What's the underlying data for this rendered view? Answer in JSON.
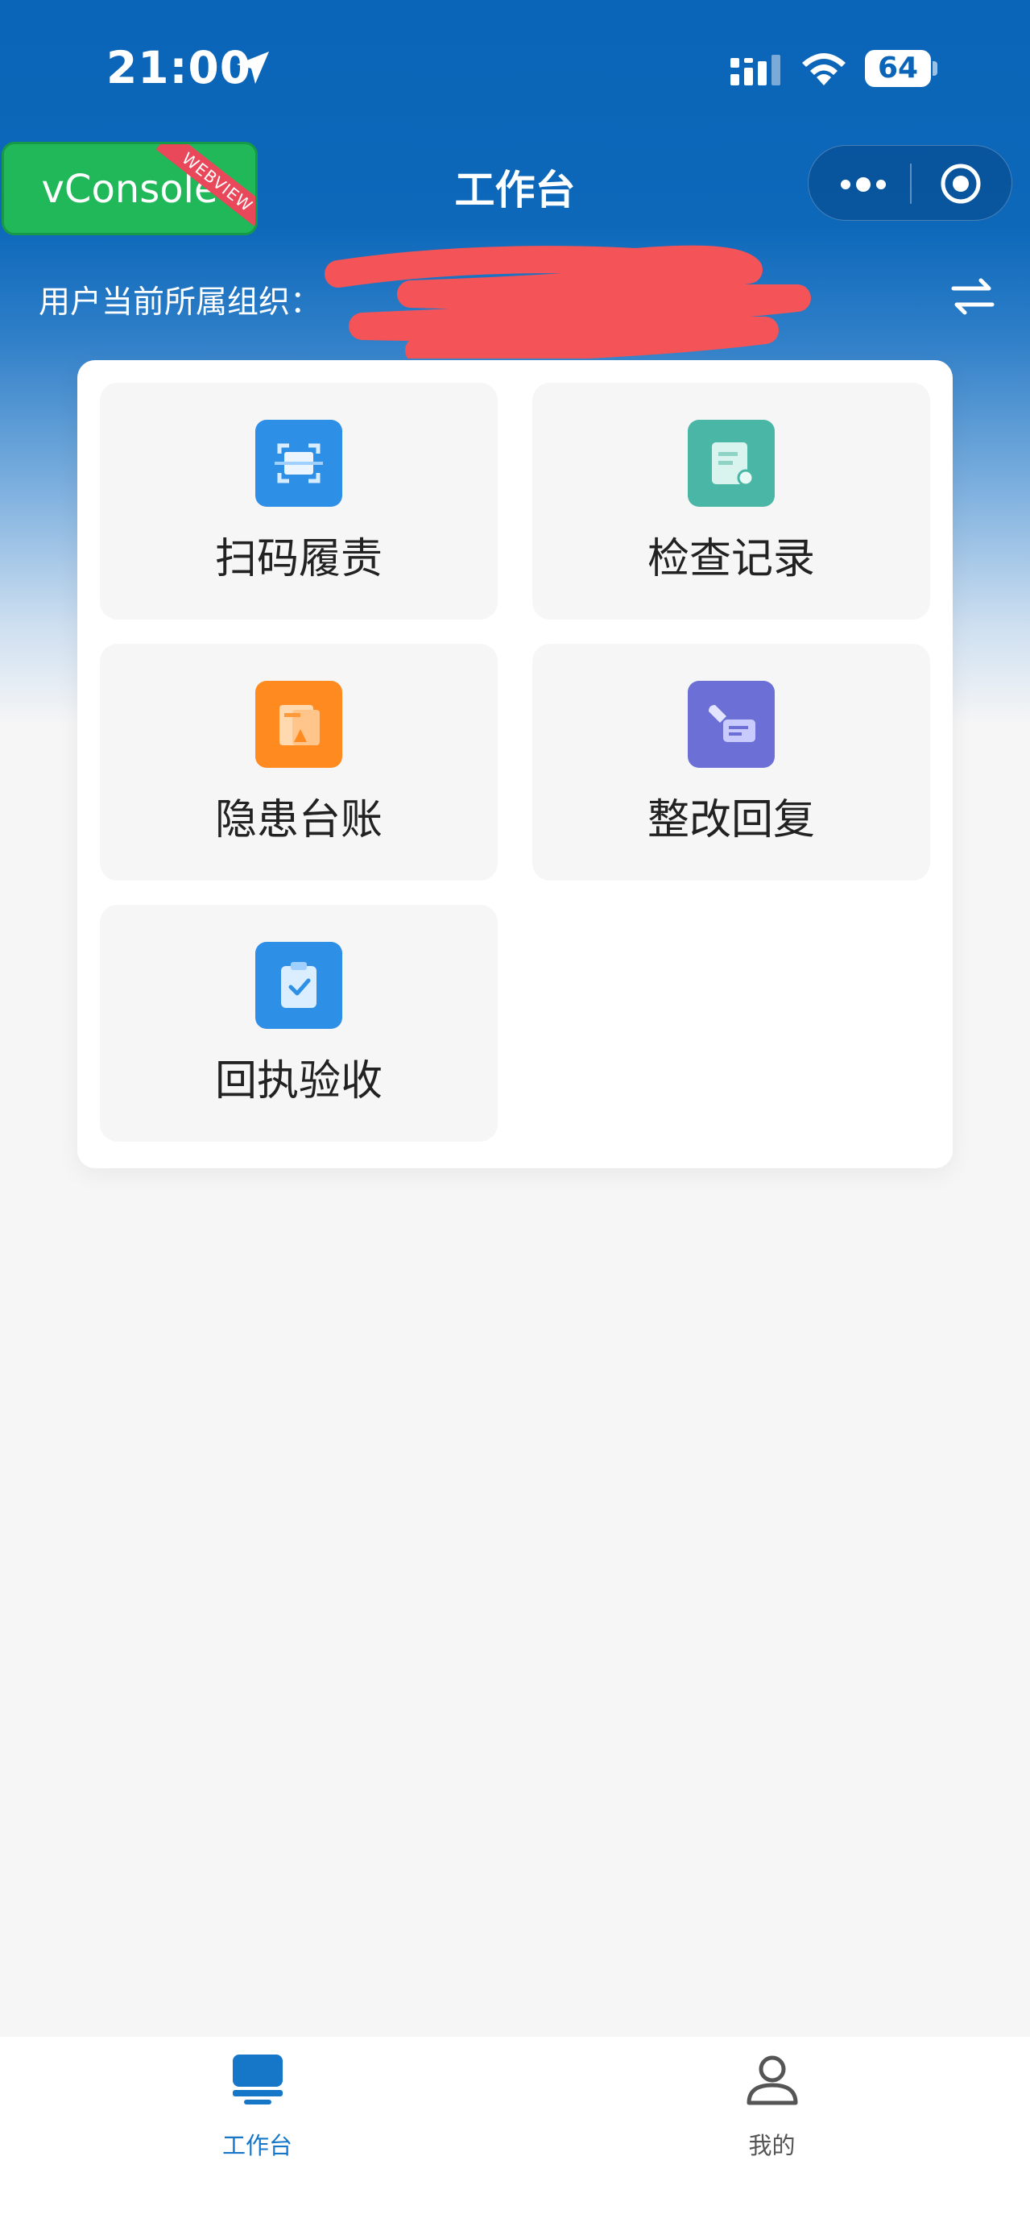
{
  "status_bar": {
    "time": "21:00",
    "battery": "64"
  },
  "vconsole": {
    "label": "vConsole",
    "ribbon": "WEBVIEW"
  },
  "nav": {
    "title": "工作台"
  },
  "org": {
    "label": "用户当前所属组织："
  },
  "tiles": [
    {
      "label": "扫码履责",
      "icon": "scan-icon",
      "color": "#2e8fe6"
    },
    {
      "label": "检查记录",
      "icon": "record-icon",
      "color": "#49b6a6"
    },
    {
      "label": "隐患台账",
      "icon": "hazard-ledger-icon",
      "color": "#ff8a1f"
    },
    {
      "label": "整改回复",
      "icon": "rectify-reply-icon",
      "color": "#6b6fd6"
    },
    {
      "label": "回执验收",
      "icon": "receipt-icon",
      "color": "#2e8fe6"
    }
  ],
  "tabbar": {
    "items": [
      {
        "label": "工作台",
        "icon": "workbench-icon",
        "active": true,
        "color": "#1677c9"
      },
      {
        "label": "我的",
        "icon": "person-icon",
        "active": false,
        "color": "#555555"
      }
    ]
  }
}
